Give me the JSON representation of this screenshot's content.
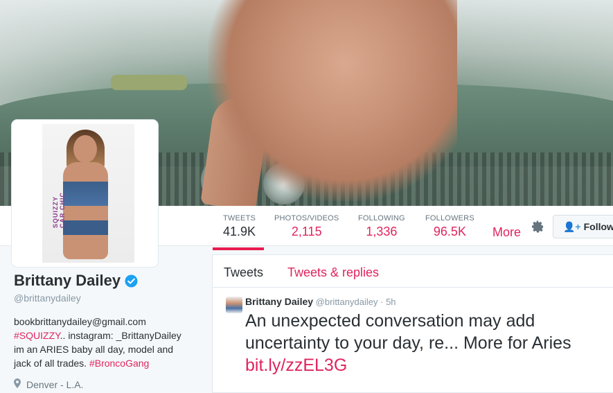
{
  "banner": {
    "alt": ""
  },
  "profile": {
    "name": "Brittany Dailey",
    "handle": "@brittanydailey",
    "bio_email": "bookbrittanydailey@gmail.com",
    "bio_tag1": "#SQUIZZY",
    "bio_text1": ".. instagram: _BrittanyDailey im an ARIES baby all day, model and jack of all trades.",
    "bio_tag2": "#BroncoGang",
    "location": "Denver - L.A.",
    "avatar_brand": "SQUIZZY CAR CHIC",
    "verified_color": "#1da1f2"
  },
  "stats": [
    {
      "label": "TWEETS",
      "value": "41.9K"
    },
    {
      "label": "PHOTOS/VIDEOS",
      "value": "2,115"
    },
    {
      "label": "FOLLOWING",
      "value": "1,336"
    },
    {
      "label": "FOLLOWERS",
      "value": "96.5K"
    }
  ],
  "nav": {
    "more": "More",
    "follow": "Follow",
    "gear_icon": "gear-icon"
  },
  "tabs": {
    "tweets": "Tweets",
    "replies": "Tweets & replies"
  },
  "tweet": {
    "author": "Brittany Dailey",
    "handle": "@brittanydailey",
    "sep": "·",
    "time": "5h",
    "text": "An unexpected conversation may add uncertainty to your day, re... More for Aries",
    "link": "bit.ly/zzEL3G"
  },
  "colors": {
    "accent": "#e0245e",
    "active_underline": "#e81c4f"
  }
}
